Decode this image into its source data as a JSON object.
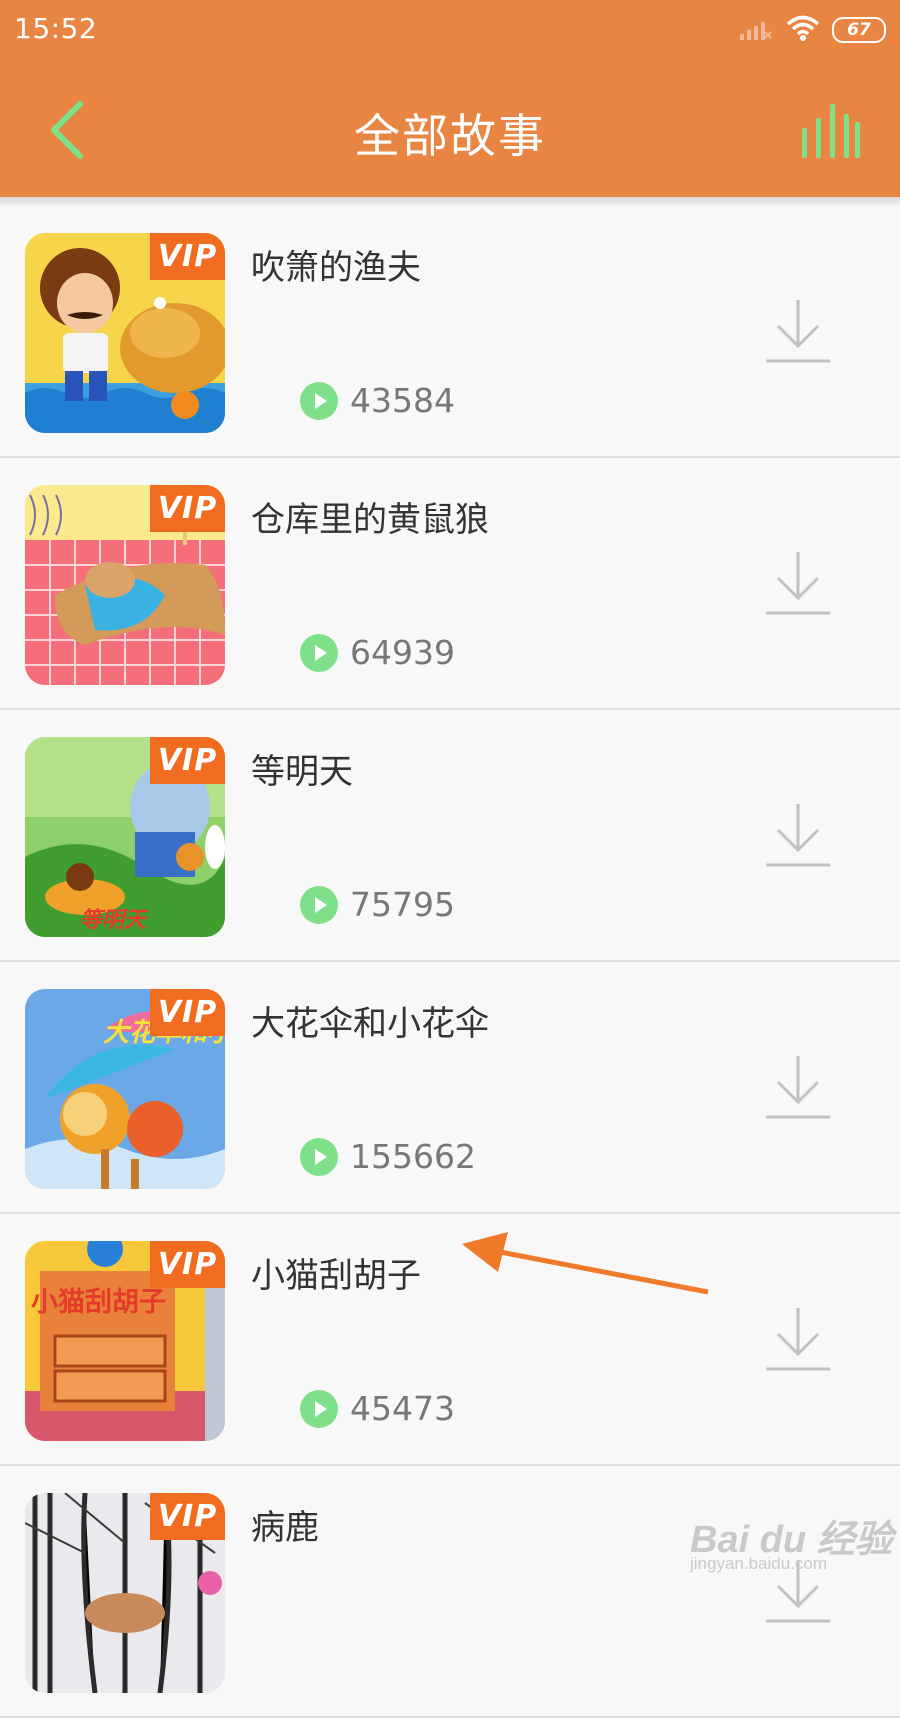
{
  "status_bar": {
    "time": "15:52",
    "battery": "67"
  },
  "header": {
    "title": "全部故事"
  },
  "colors": {
    "brand": "#e98543",
    "accent_green": "#7fe08a",
    "vip": "#f06c20"
  },
  "stories": [
    {
      "title": "吹箫的渔夫",
      "plays": "43584",
      "badge": "VIP"
    },
    {
      "title": "仓库里的黄鼠狼",
      "plays": "64939",
      "badge": "VIP"
    },
    {
      "title": "等明天",
      "plays": "75795",
      "badge": "VIP",
      "cover_text": "等明天"
    },
    {
      "title": "大花伞和小花伞",
      "plays": "155662",
      "badge": "VIP",
      "cover_text": "大花伞和小花伞"
    },
    {
      "title": "小猫刮胡子",
      "plays": "45473",
      "badge": "VIP",
      "cover_text": "小猫刮胡子"
    },
    {
      "title": "病鹿",
      "plays": "",
      "badge": "VIP"
    }
  ],
  "watermark": {
    "logo": "Bai du 经验",
    "sub": "jingyan.baidu.com"
  }
}
